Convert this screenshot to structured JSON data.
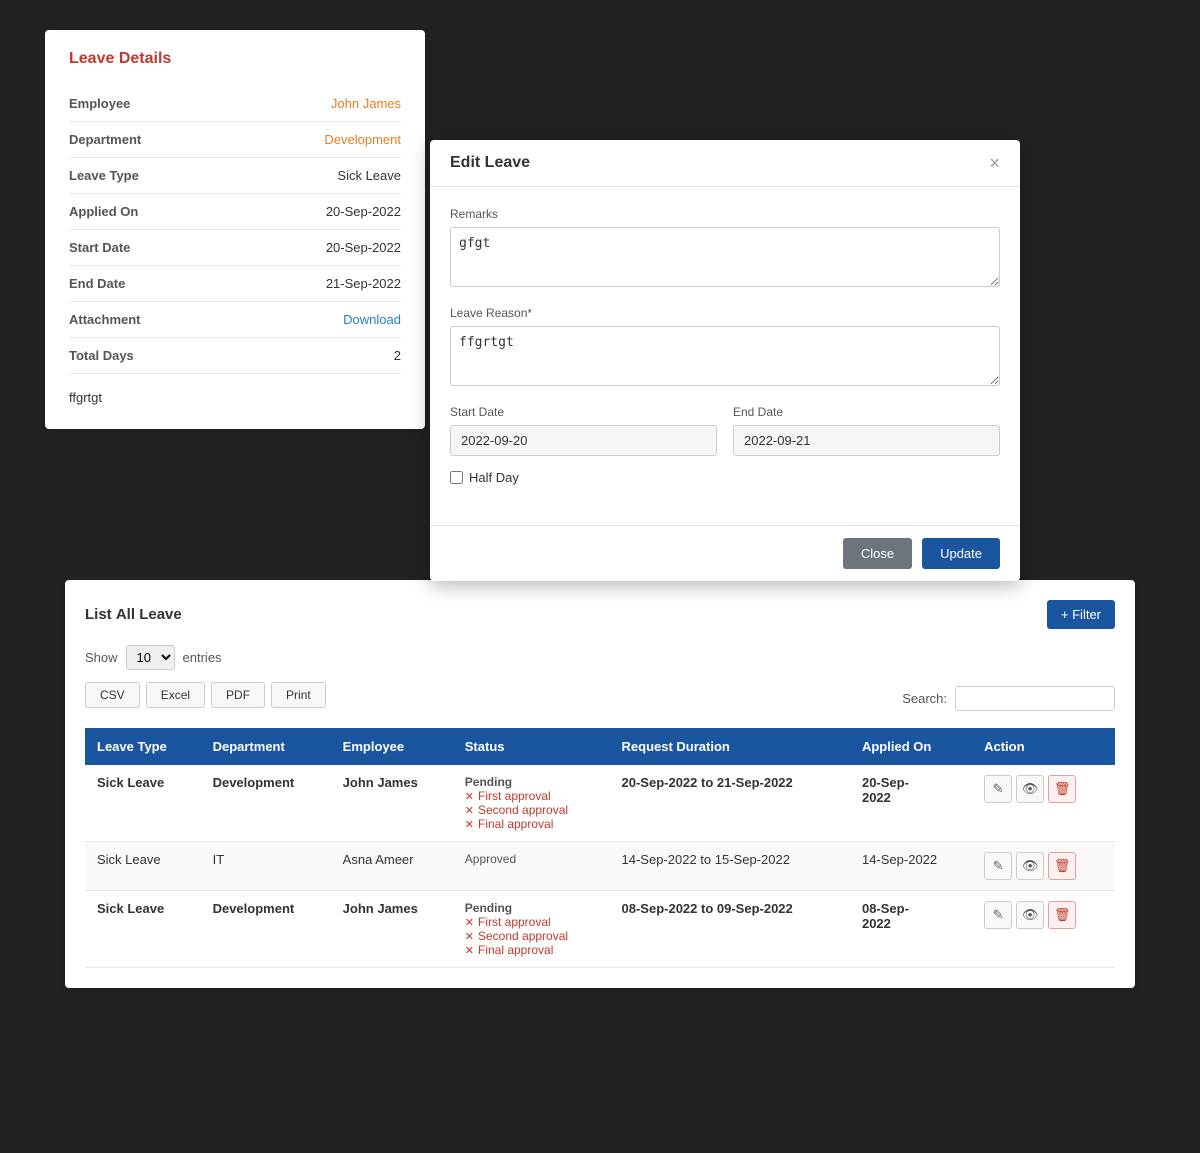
{
  "leaveDetails": {
    "title": "Leave Details",
    "fields": [
      {
        "label": "Employee",
        "value": "John James",
        "type": "orange"
      },
      {
        "label": "Department",
        "value": "Development",
        "type": "orange"
      },
      {
        "label": "Leave Type",
        "value": "Sick Leave",
        "type": "normal"
      },
      {
        "label": "Applied On",
        "value": "20-Sep-2022",
        "type": "normal"
      },
      {
        "label": "Start Date",
        "value": "20-Sep-2022",
        "type": "normal"
      },
      {
        "label": "End Date",
        "value": "21-Sep-2022",
        "type": "normal"
      },
      {
        "label": "Attachment",
        "value": "Download",
        "type": "link"
      },
      {
        "label": "Total Days",
        "value": "2",
        "type": "normal"
      }
    ],
    "remarks": "ffgrtgt"
  },
  "editLeave": {
    "title": "Edit Leave",
    "close_label": "×",
    "remarks_label": "Remarks",
    "remarks_value": "gfgt",
    "leave_reason_label": "Leave Reason*",
    "leave_reason_value": "ffgrtgt",
    "start_date_label": "Start Date",
    "start_date_value": "2022-09-20",
    "end_date_label": "End Date",
    "end_date_value": "2022-09-21",
    "half_day_label": "Half Day",
    "close_btn": "Close",
    "update_btn": "Update"
  },
  "listLeave": {
    "title_prefix": "List",
    "title_bold": "All",
    "title_suffix": "Leave",
    "filter_btn": "+ Filter",
    "show_label": "Show",
    "entries_label": "entries",
    "show_value": "10",
    "export_buttons": [
      "CSV",
      "Excel",
      "PDF",
      "Print"
    ],
    "search_label": "Search:",
    "columns": [
      "Leave Type",
      "Department",
      "Employee",
      "Status",
      "Request Duration",
      "Applied On",
      "Action"
    ],
    "rows": [
      {
        "leave_type": "Sick Leave",
        "department": "Development",
        "employee": "John James",
        "status_main": "Pending",
        "approvals": [
          "First approval",
          "Second approval",
          "Final approval"
        ],
        "duration": "20-Sep-2022 to 21-Sep-2022",
        "applied_on": "20-Sep-2022",
        "bold": true
      },
      {
        "leave_type": "Sick Leave",
        "department": "IT",
        "employee": "Asna Ameer",
        "status_main": "Approved",
        "approvals": [],
        "duration": "14-Sep-2022 to 15-Sep-2022",
        "applied_on": "14-Sep-2022",
        "bold": false
      },
      {
        "leave_type": "Sick Leave",
        "department": "Development",
        "employee": "John James",
        "status_main": "Pending",
        "approvals": [
          "First approval",
          "Second approval",
          "Final approval"
        ],
        "duration": "08-Sep-2022 to 09-Sep-2022",
        "applied_on": "08-Sep-2022",
        "bold": true
      }
    ]
  }
}
